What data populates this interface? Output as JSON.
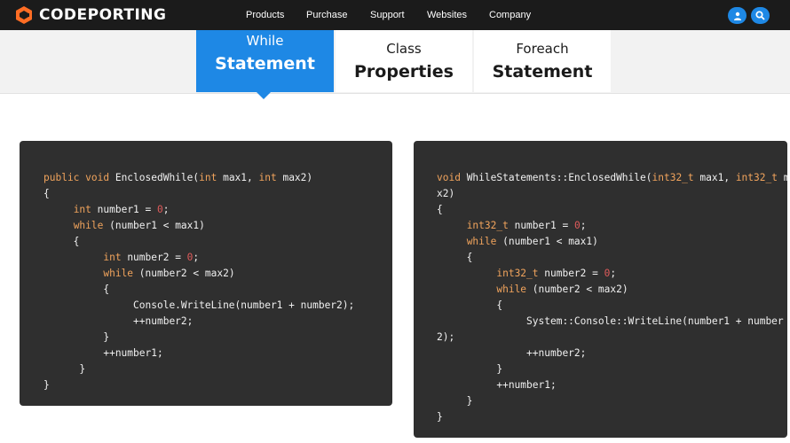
{
  "header": {
    "brand": "CODEPORTING",
    "nav": [
      "Products",
      "Purchase",
      "Support",
      "Websites",
      "Company"
    ],
    "user_icon": "user-icon",
    "search_icon": "search-icon",
    "colors": {
      "topbar": "#1b1b1b",
      "accent": "#1e88e5",
      "logo": "#ff6d24"
    }
  },
  "tabs": [
    {
      "small": "While",
      "big": "Statement",
      "active": true
    },
    {
      "small": "Class",
      "big": "Properties",
      "active": false
    },
    {
      "small": "Foreach",
      "big": "Statement",
      "active": false
    }
  ],
  "code_left": [
    [
      [
        "public void ",
        "kw"
      ],
      [
        "EnclosedWhile(",
        ""
      ],
      [
        "int",
        "kw"
      ],
      [
        " max1, ",
        ""
      ],
      [
        "int",
        "kw"
      ],
      [
        " max2)",
        ""
      ]
    ],
    [
      [
        "{",
        ""
      ]
    ],
    [
      [
        "     ",
        ""
      ],
      [
        "int",
        "kw"
      ],
      [
        " number1 = ",
        ""
      ],
      [
        "0",
        "num"
      ],
      [
        ";",
        ""
      ]
    ],
    [
      [
        "     ",
        ""
      ],
      [
        "while",
        "kw"
      ],
      [
        " (number1 < max1)",
        ""
      ]
    ],
    [
      [
        "     {",
        ""
      ]
    ],
    [
      [
        "          ",
        ""
      ],
      [
        "int",
        "kw"
      ],
      [
        " number2 = ",
        ""
      ],
      [
        "0",
        "num"
      ],
      [
        ";",
        ""
      ]
    ],
    [
      [
        "          ",
        ""
      ],
      [
        "while",
        "kw"
      ],
      [
        " (number2 < max2)",
        ""
      ]
    ],
    [
      [
        "          {",
        ""
      ]
    ],
    [
      [
        "               Console.WriteLine(number1 + number2);",
        ""
      ]
    ],
    [
      [
        "               ++number2;",
        ""
      ]
    ],
    [
      [
        "          }",
        ""
      ]
    ],
    [
      [
        "          ++number1;",
        ""
      ]
    ],
    [
      [
        "      }",
        ""
      ]
    ],
    [
      [
        "}",
        ""
      ]
    ]
  ],
  "code_right": [
    [
      [
        "void ",
        "kw"
      ],
      [
        "WhileStatements::EnclosedWhile(",
        ""
      ],
      [
        "int32_t",
        "kw"
      ],
      [
        " max1, ",
        ""
      ],
      [
        "int32_t",
        "kw"
      ],
      [
        " ma",
        ""
      ]
    ],
    [
      [
        "x2)",
        ""
      ]
    ],
    [
      [
        "{",
        ""
      ]
    ],
    [
      [
        "     ",
        ""
      ],
      [
        "int32_t",
        "kw"
      ],
      [
        " number1 = ",
        ""
      ],
      [
        "0",
        "num"
      ],
      [
        ";",
        ""
      ]
    ],
    [
      [
        "     ",
        ""
      ],
      [
        "while",
        "kw"
      ],
      [
        " (number1 < max1)",
        ""
      ]
    ],
    [
      [
        "     {",
        ""
      ]
    ],
    [
      [
        "          ",
        ""
      ],
      [
        "int32_t",
        "kw"
      ],
      [
        " number2 = ",
        ""
      ],
      [
        "0",
        "num"
      ],
      [
        ";",
        ""
      ]
    ],
    [
      [
        "          ",
        ""
      ],
      [
        "while",
        "kw"
      ],
      [
        " (number2 < max2)",
        ""
      ]
    ],
    [
      [
        "          {",
        ""
      ]
    ],
    [
      [
        "               System::Console::WriteLine(number1 + number",
        ""
      ]
    ],
    [
      [
        "2);",
        ""
      ]
    ],
    [
      [
        "               ++number2;",
        ""
      ]
    ],
    [
      [
        "          }",
        ""
      ]
    ],
    [
      [
        "          ++number1;",
        ""
      ]
    ],
    [
      [
        "     }",
        ""
      ]
    ],
    [
      [
        "}",
        ""
      ]
    ]
  ]
}
